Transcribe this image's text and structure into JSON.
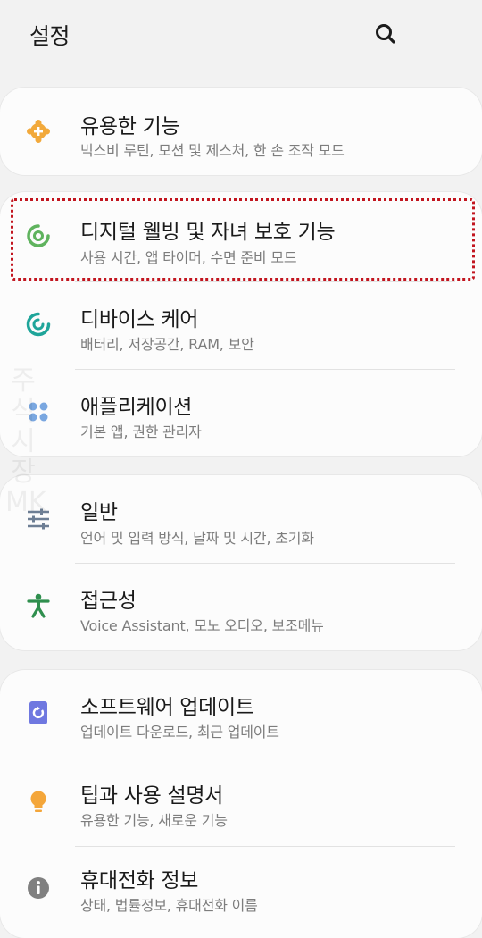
{
  "header": {
    "title": "설정",
    "search_icon": "search-icon"
  },
  "cards": [
    {
      "items": [
        {
          "title": "유용한 기능",
          "subtitle": "빅스비 루틴, 모션 및 제스처, 한 손 조작 모드",
          "icon": "puzzle-plus-icon",
          "color": "#f2a93b"
        }
      ]
    },
    {
      "items": [
        {
          "title": "디지털 웰빙 및 자녀 보호 기능",
          "subtitle": "사용 시간, 앱 타이머, 수면 준비 모드",
          "icon": "digital-wellbeing-icon",
          "color": "#5fb35e"
        },
        {
          "title": "디바이스 케어",
          "subtitle": "배터리, 저장공간, RAM, 보안",
          "icon": "device-care-icon",
          "color": "#1fa59a"
        },
        {
          "title": "애플리케이션",
          "subtitle": "기본 앱, 권한 관리자",
          "icon": "apps-grid-icon",
          "color": "#7aa7e0"
        }
      ]
    },
    {
      "items": [
        {
          "title": "일반",
          "subtitle": "언어 및 입력 방식, 날짜 및 시간, 초기화",
          "icon": "sliders-icon",
          "color": "#6d7e94"
        },
        {
          "title": "접근성",
          "subtitle": "Voice Assistant, 모노 오디오, 보조메뉴",
          "icon": "accessibility-icon",
          "color": "#2f8f4e"
        }
      ]
    },
    {
      "items": [
        {
          "title": "소프트웨어 업데이트",
          "subtitle": "업데이트 다운로드, 최근 업데이트",
          "icon": "software-update-icon",
          "color": "#6f78e0"
        },
        {
          "title": "팁과 사용 설명서",
          "subtitle": "유용한 기능, 새로운 기능",
          "icon": "lightbulb-icon",
          "color": "#f4a63a"
        },
        {
          "title": "휴대전화 정보",
          "subtitle": "상태, 법률정보, 휴대전화 이름",
          "icon": "info-icon",
          "color": "#808080"
        }
      ]
    }
  ],
  "watermark": "주식시장MK"
}
